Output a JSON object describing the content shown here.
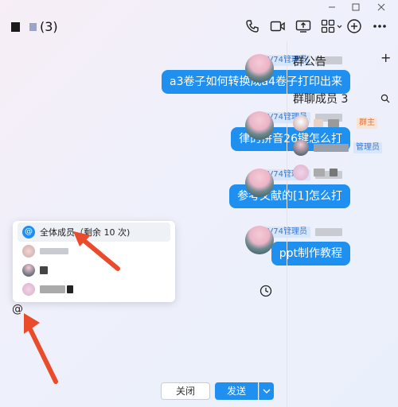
{
  "window": {
    "title_count": "(3)"
  },
  "messages": [
    {
      "role": "LV74管理员",
      "text": "a3卷子如何转换成a4卷子打印出来"
    },
    {
      "role": "LV74管理员",
      "text": "律的拼音26键怎么打"
    },
    {
      "role": "LV74管理员",
      "text": "参考文献的[1]怎么打"
    },
    {
      "role": "LV74管理员",
      "text": "ppt制作教程"
    }
  ],
  "mention_popup": {
    "all_label": "全体成员（剩余 10 次)",
    "at_symbol": "@"
  },
  "input": {
    "text": "@"
  },
  "buttons": {
    "close": "关闭",
    "send": "发送"
  },
  "right_panel": {
    "announcement_title": "群公告",
    "members_title": "群聊成员 3",
    "owner_tag": "群主",
    "admin_tag": "管理员",
    "add_symbol": "+"
  },
  "colors": {
    "accent": "#1f8ff0",
    "admin_tag": "#3a78d0",
    "owner_tag": "#e2763c",
    "arrow": "#e94b2b"
  }
}
